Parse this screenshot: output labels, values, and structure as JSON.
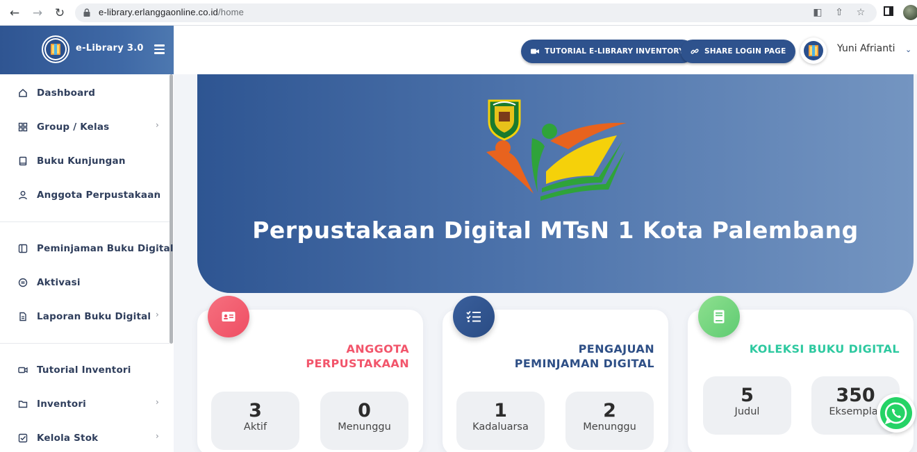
{
  "browser": {
    "url_domain": "e-library.erlanggaonline.co.id",
    "url_path": "/home"
  },
  "brand": {
    "title": "e-Library 3.0"
  },
  "header": {
    "tutorial_btn": "TUTORIAL E-LIBRARY INVENTORY",
    "share_btn": "SHARE LOGIN PAGE",
    "user_name": "Yuni Afrianti"
  },
  "sidebar": {
    "items": [
      {
        "label": "Dashboard",
        "icon": "home-icon",
        "has_chevron": false
      },
      {
        "label": "Group / Kelas",
        "icon": "grid-icon",
        "has_chevron": true
      },
      {
        "label": "Buku Kunjungan",
        "icon": "book-icon",
        "has_chevron": false
      },
      {
        "label": "Anggota Perpustakaan",
        "icon": "user-icon",
        "has_chevron": true
      },
      {
        "label": "Peminjaman Buku Digital",
        "icon": "sidebar-panel-icon",
        "has_chevron": true
      },
      {
        "label": "Aktivasi",
        "icon": "activation-icon",
        "has_chevron": false
      },
      {
        "label": "Laporan Buku Digital",
        "icon": "document-icon",
        "has_chevron": true
      },
      {
        "label": "Tutorial Inventori",
        "icon": "video-icon",
        "has_chevron": false
      },
      {
        "label": "Inventori",
        "icon": "folder-icon",
        "has_chevron": true
      },
      {
        "label": "Kelola Stok",
        "icon": "checkbox-icon",
        "has_chevron": true
      }
    ]
  },
  "hero": {
    "title": "Perpustakaan Digital MTsN 1 Kota Palembang"
  },
  "cards": {
    "anggota": {
      "title_line1": "ANGGOTA",
      "title_line2": "PERPUSTAKAAN",
      "color": "#f2556b",
      "stats": [
        {
          "value": "3",
          "label": "Aktif"
        },
        {
          "value": "0",
          "label": "Menunggu"
        }
      ]
    },
    "pengajuan": {
      "title_line1": "PENGAJUAN",
      "title_line2": "PEMINJAMAN DIGITAL",
      "color": "#2e4f86",
      "stats": [
        {
          "value": "1",
          "label": "Kadaluarsa"
        },
        {
          "value": "2",
          "label": "Menunggu"
        }
      ]
    },
    "koleksi": {
      "title_line1": "KOLEKSI BUKU DIGITAL",
      "color": "#2ec9a0",
      "stats": [
        {
          "value": "5",
          "label": "Judul"
        },
        {
          "value": "350",
          "label": "Eksemplar"
        }
      ]
    }
  },
  "colors": {
    "primary": "#2e528d",
    "whatsapp": "#25d366"
  }
}
